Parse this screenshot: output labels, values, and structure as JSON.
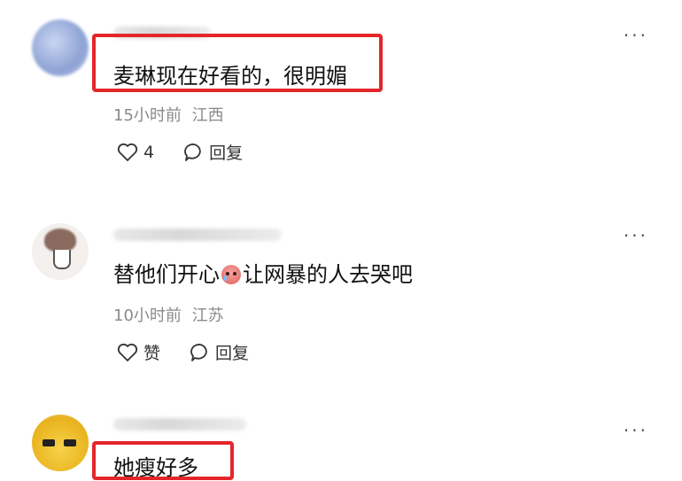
{
  "comments": [
    {
      "text": "麦琳现在好看的，很明媚",
      "time": "15小时前",
      "location": "江西",
      "likes": "4",
      "reply_label": "回复",
      "highlighted": true
    },
    {
      "text_before_emoji": "替他们开心",
      "text_after_emoji": "让网暴的人去哭吧",
      "emoji": "crying-face",
      "time": "10小时前",
      "location": "江苏",
      "likes": "赞",
      "reply_label": "回复",
      "highlighted": false
    },
    {
      "text": "她瘦好多",
      "highlighted": true
    }
  ],
  "more_label": "···",
  "colors": {
    "highlight": "#e4262a",
    "meta": "#8a8a8a"
  }
}
